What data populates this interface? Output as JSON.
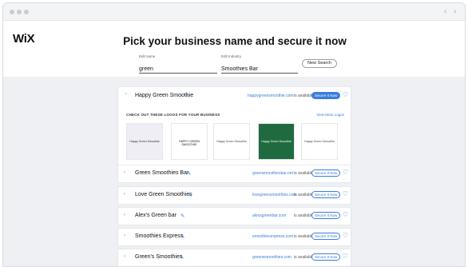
{
  "header": {
    "logo": "WiX",
    "headline": "Pick your business name and secure it now",
    "edit_name_label": "Edit name",
    "edit_name_value": "green",
    "edit_industry_label": "Edit Industry",
    "edit_industry_value": "Smoothies Bar",
    "new_search_label": "New Search"
  },
  "featured": {
    "name": "Happy Green Smoothie",
    "domain": "happygreensmoothie.com",
    "available": "is available",
    "secure_label": "Secure It Now",
    "logos_heading": "CHECK OUT THESE LOGOS FOR YOUR BUSINESS",
    "view_more": "View More Logos",
    "logos": [
      {
        "text": "Happy Green Smoothie",
        "bg": "#efeef7",
        "color": "#333333"
      },
      {
        "text": "HAPPY GREEN SMOOTHIE",
        "bg": "#ffffff",
        "color": "#111111"
      },
      {
        "text": "Happy Green Smoothie",
        "bg": "#ffffff",
        "color": "#444444"
      },
      {
        "text": "Happy Green Smoothie",
        "bg": "#1f6b3f",
        "color": "#ffffff"
      },
      {
        "text": "Happy Green Smoothie",
        "bg": "#ffffff",
        "color": "#444444"
      }
    ]
  },
  "results": [
    {
      "name": "Green Smoothies Bar",
      "domain": "greensmoothiesbar.net",
      "available": "is available",
      "secure_label": "Secure It Now"
    },
    {
      "name": "Love Green Smoothies",
      "domain": "lovegreensmoothies.com",
      "available": "is available",
      "secure_label": "Secure It Now"
    },
    {
      "name": "Alex's Green bar",
      "domain": "alexsgreenbar.com",
      "available": "is available",
      "secure_label": "Secure It Now"
    },
    {
      "name": "Smoothies Express",
      "domain": "smoothiesexpress.com",
      "available": "is available",
      "secure_label": "Secure It Now"
    },
    {
      "name": "Green's Smoothies",
      "domain": "greenssmoothies.com",
      "available": "is available",
      "secure_label": "Secure It Now"
    }
  ],
  "colors": {
    "accent": "#3b7ddd",
    "page_bg": "#eef0f3"
  }
}
